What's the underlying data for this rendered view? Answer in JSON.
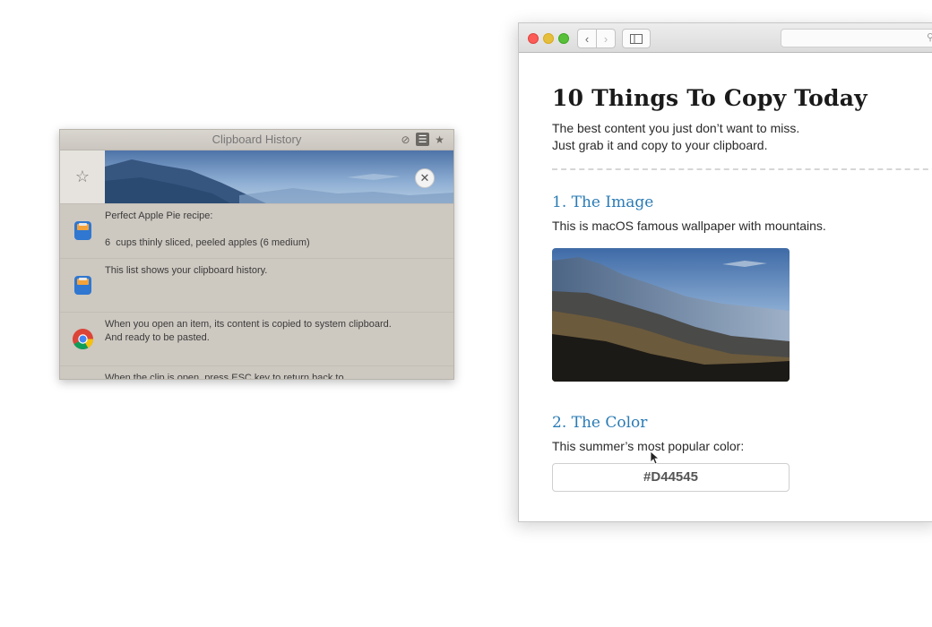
{
  "clipboard": {
    "title": "Clipboard History",
    "tool_icons": [
      "clear-icon",
      "list-icon",
      "star-icon"
    ],
    "items": [
      {
        "type": "image",
        "app_icon": "image-thumbnail",
        "starred_icon": "star-outline-icon"
      },
      {
        "type": "text",
        "app_icon": "clipboard-app-icon",
        "text": "Perfect Apple Pie recipe:\n\n6  cups thinly sliced, peeled apples (6 medium)"
      },
      {
        "type": "text",
        "app_icon": "clipboard-app-icon",
        "text": "This list shows your clipboard history."
      },
      {
        "type": "text",
        "app_icon": "chrome-icon",
        "text": "When you open an item, its content is copied to system clipboard.\nAnd ready to be pasted."
      },
      {
        "type": "text",
        "app_icon": "none",
        "text": "When the clip is open, press ESC key to return back to"
      }
    ]
  },
  "browser": {
    "heading": "10 Things To Copy Today",
    "intro": [
      "The best content you just don’t want to miss.",
      "Just grab it and copy to your clipboard."
    ],
    "section1": {
      "title": "1. The Image",
      "text": "This is macOS famous wallpaper with mountains."
    },
    "section2": {
      "title": "2. The Color",
      "text": "This summer’s most popular color:",
      "color_value": "#D44545"
    }
  }
}
